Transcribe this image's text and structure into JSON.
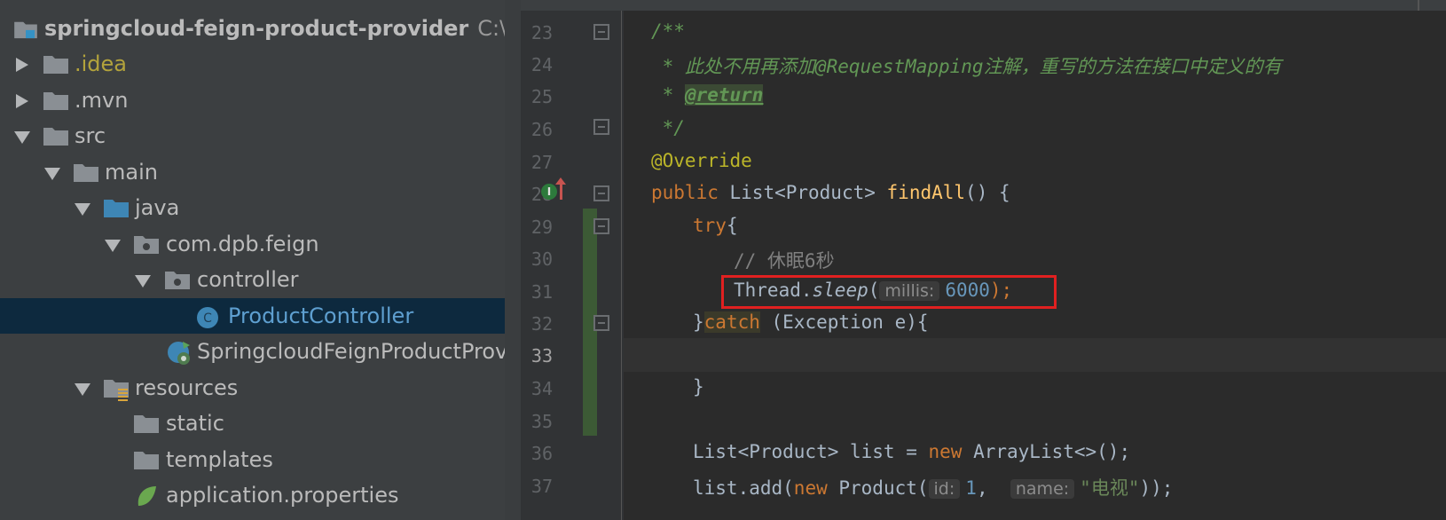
{
  "project_tree": {
    "items": [
      {
        "label": "springcloud-feign-product-provider",
        "path": "C:\\tools"
      },
      {
        "label": ".idea"
      },
      {
        "label": ".mvn"
      },
      {
        "label": "src"
      },
      {
        "label": "main"
      },
      {
        "label": "java"
      },
      {
        "label": "com.dpb.feign"
      },
      {
        "label": "controller"
      },
      {
        "label": "ProductController"
      },
      {
        "label": "SpringcloudFeignProductProvic"
      },
      {
        "label": "resources"
      },
      {
        "label": "static"
      },
      {
        "label": "templates"
      },
      {
        "label": "application.properties"
      }
    ]
  },
  "editor": {
    "line_numbers": [
      "23",
      "24",
      "25",
      "26",
      "27",
      "28",
      "29",
      "30",
      "31",
      "32",
      "33",
      "34",
      "35",
      "36",
      "37"
    ],
    "l23": "/**",
    "l24": " * 此处不用再添加@RequestMapping注解，重写的方法在接口中定义的有",
    "l25_star": " * ",
    "l25_tag": "@return",
    "l26": " */",
    "l27": "@Override",
    "l28_kw": "public ",
    "l28_type": "List<Product> ",
    "l28_fn": "findAll",
    "l28_rest": "() {",
    "l29_kw": "try",
    "l29_rest": "{",
    "l30": "// 休眠6秒",
    "l31_cls": "Thread.",
    "l31_method": "sleep",
    "l31_open": "(",
    "l31_hint": "millis:",
    "l31_num": "6000",
    "l31_close": ");",
    "l32_open": "}",
    "l32_kw": "catch",
    "l32_rest": " (Exception e){",
    "l34": "}",
    "l36_a": "List<Product> list = ",
    "l36_kw": "new ",
    "l36_b": "ArrayList<>();",
    "l37_a": "list.add(",
    "l37_kw": "new ",
    "l37_b": "Product(",
    "l37_hint1": "id:",
    "l37_num": "1",
    "l37_comma": ",  ",
    "l37_hint2": "name:",
    "l37_str": "\"电视\"",
    "l37_end": "));"
  },
  "colors": {
    "comment_doc": "#629755",
    "keyword": "#cc7832",
    "annotation": "#bbb529",
    "method": "#ffc66d",
    "number": "#6897bb",
    "string": "#6a8759",
    "highlight_box": "#e02020"
  }
}
